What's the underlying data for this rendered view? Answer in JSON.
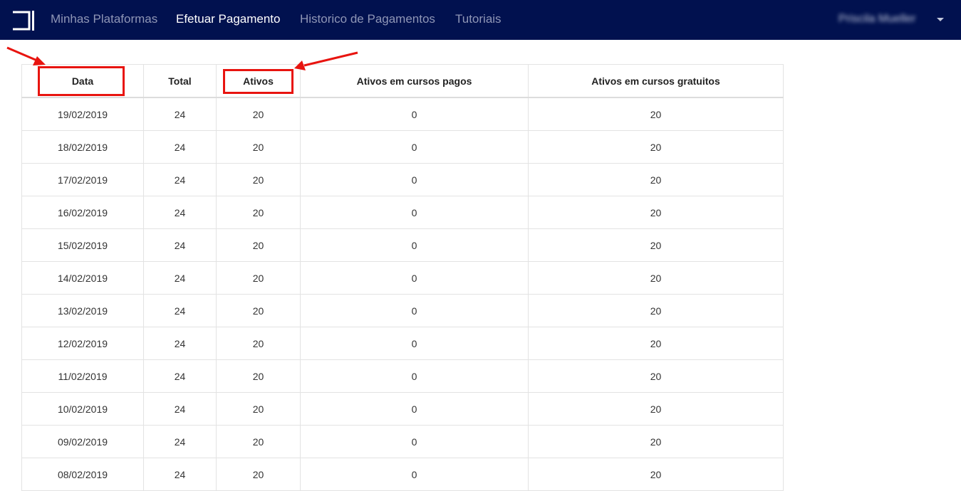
{
  "nav": {
    "links": [
      {
        "label": "Minhas Plataformas",
        "active": false
      },
      {
        "label": "Efetuar Pagamento",
        "active": true
      },
      {
        "label": "Historico de Pagamentos",
        "active": false
      },
      {
        "label": "Tutoriais",
        "active": false
      }
    ],
    "user_name": "Priscila Mueller",
    "logo_icon": "bracket-logo-icon",
    "dropdown_icon": "caret-down-icon"
  },
  "colors": {
    "navbar_bg": "#01114f",
    "annotation_red": "#e8140f"
  },
  "table": {
    "headers": [
      "Data",
      "Total",
      "Ativos",
      "Ativos em cursos pagos",
      "Ativos em cursos gratuitos"
    ],
    "rows": [
      [
        "19/02/2019",
        "24",
        "20",
        "0",
        "20"
      ],
      [
        "18/02/2019",
        "24",
        "20",
        "0",
        "20"
      ],
      [
        "17/02/2019",
        "24",
        "20",
        "0",
        "20"
      ],
      [
        "16/02/2019",
        "24",
        "20",
        "0",
        "20"
      ],
      [
        "15/02/2019",
        "24",
        "20",
        "0",
        "20"
      ],
      [
        "14/02/2019",
        "24",
        "20",
        "0",
        "20"
      ],
      [
        "13/02/2019",
        "24",
        "20",
        "0",
        "20"
      ],
      [
        "12/02/2019",
        "24",
        "20",
        "0",
        "20"
      ],
      [
        "11/02/2019",
        "24",
        "20",
        "0",
        "20"
      ],
      [
        "10/02/2019",
        "24",
        "20",
        "0",
        "20"
      ],
      [
        "09/02/2019",
        "24",
        "20",
        "0",
        "20"
      ],
      [
        "08/02/2019",
        "24",
        "20",
        "0",
        "20"
      ]
    ]
  }
}
